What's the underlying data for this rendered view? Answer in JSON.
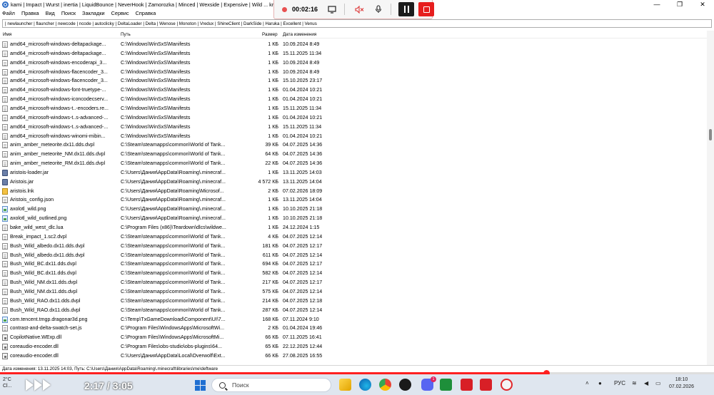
{
  "window": {
    "title": "kami | Impact | Wurst | inertia | LiquidBounce | NeverHook | Zamorozka | Minced | Wexside | Expensive | Wild ... krien | celestial | calestial | deadcode | nova-dev | Bebra... - Everything",
    "controls": [
      "—",
      "❐",
      "✕"
    ]
  },
  "recorder": {
    "time": "00:02:16"
  },
  "menu": [
    "Файл",
    "Правка",
    "Вид",
    "Поиск",
    "Закладки",
    "Сервис",
    "Справка"
  ],
  "bookmarks": "| newlauncher | flauncher | newcode | ncode | autoclicky | DeltaLoader | Delta | Wenose | Monoton | Vredux | ShineClient | DarkSide | Haruka | Excellent | Venus",
  "columns": {
    "name": "Имя",
    "path": "Путь",
    "size": "Размер",
    "date": "Дата изменения"
  },
  "rows": [
    {
      "icon": "doc",
      "name": "amd64_microsoft-windows-deltapackage...",
      "path": "C:\\Windows\\WinSxS\\Manifests",
      "size": "1 КБ",
      "date": "10.09.2024 8:49"
    },
    {
      "icon": "doc",
      "name": "amd64_microsoft-windows-deltapackage...",
      "path": "C:\\Windows\\WinSxS\\Manifests",
      "size": "1 КБ",
      "date": "15.11.2025 11:34"
    },
    {
      "icon": "doc",
      "name": "amd64_microsoft-windows-encoderapi_3...",
      "path": "C:\\Windows\\WinSxS\\Manifests",
      "size": "1 КБ",
      "date": "10.09.2024 8:49"
    },
    {
      "icon": "doc",
      "name": "amd64_microsoft-windows-flacencoder_3...",
      "path": "C:\\Windows\\WinSxS\\Manifests",
      "size": "1 КБ",
      "date": "10.09.2024 8:49"
    },
    {
      "icon": "doc",
      "name": "amd64_microsoft-windows-flacencoder_3...",
      "path": "C:\\Windows\\WinSxS\\Manifests",
      "size": "1 КБ",
      "date": "15.10.2025 23:17"
    },
    {
      "icon": "doc",
      "name": "amd64_microsoft-windows-font-truetype-...",
      "path": "C:\\Windows\\WinSxS\\Manifests",
      "size": "1 КБ",
      "date": "01.04.2024 10:21"
    },
    {
      "icon": "doc",
      "name": "amd64_microsoft-windows-iconcodecserv...",
      "path": "C:\\Windows\\WinSxS\\Manifests",
      "size": "1 КБ",
      "date": "01.04.2024 10:21"
    },
    {
      "icon": "doc",
      "name": "amd64_microsoft-windows-t..-encoders.re...",
      "path": "C:\\Windows\\WinSxS\\Manifests",
      "size": "1 КБ",
      "date": "15.11.2025 11:34"
    },
    {
      "icon": "doc",
      "name": "amd64_microsoft-windows-t..s-advanced-...",
      "path": "C:\\Windows\\WinSxS\\Manifests",
      "size": "1 КБ",
      "date": "01.04.2024 10:21"
    },
    {
      "icon": "doc",
      "name": "amd64_microsoft-windows-t..s-advanced-...",
      "path": "C:\\Windows\\WinSxS\\Manifests",
      "size": "1 КБ",
      "date": "15.11.2025 11:34"
    },
    {
      "icon": "doc",
      "name": "amd64_microsoft-windows-winomi-mibin...",
      "path": "C:\\Windows\\WinSxS\\Manifests",
      "size": "1 КБ",
      "date": "01.04.2024 10:21"
    },
    {
      "icon": "doc",
      "name": "anim_amber_meteorite.dx11.dds.dvpl",
      "path": "C:\\Steam\\steamapps\\common\\World of Tank...",
      "size": "39 КБ",
      "date": "04.07.2025 14:36"
    },
    {
      "icon": "doc",
      "name": "anim_amber_meteorite_NM.dx11.dds.dvpl",
      "path": "C:\\Steam\\steamapps\\common\\World of Tank...",
      "size": "64 КБ",
      "date": "04.07.2025 14:36"
    },
    {
      "icon": "doc",
      "name": "anim_amber_meteorite_RM.dx11.dds.dvpl",
      "path": "C:\\Steam\\steamapps\\common\\World of Tank...",
      "size": "22 КБ",
      "date": "04.07.2025 14:36"
    },
    {
      "icon": "jar",
      "name": "aristois-loader.jar",
      "path": "C:\\Users\\Дания\\AppData\\Roaming\\.minecraf...",
      "size": "1 КБ",
      "date": "13.11.2025 14:03"
    },
    {
      "icon": "jar",
      "name": "Aristois.jar",
      "path": "C:\\Users\\Дания\\AppData\\Roaming\\.minecraf...",
      "size": "4 572 КБ",
      "date": "13.11.2025 14:04"
    },
    {
      "icon": "lnk",
      "name": "aristois.lnk",
      "path": "C:\\Users\\Дания\\AppData\\Roaming\\Microsof...",
      "size": "2 КБ",
      "date": "07.02.2026 18:09"
    },
    {
      "icon": "doc",
      "name": "Aristois_config.json",
      "path": "C:\\Users\\Дания\\AppData\\Roaming\\.minecraf...",
      "size": "1 КБ",
      "date": "13.11.2025 14:04"
    },
    {
      "icon": "img",
      "name": "axolotl_wild.png",
      "path": "C:\\Users\\Дания\\AppData\\Roaming\\.minecraf...",
      "size": "1 КБ",
      "date": "10.10.2025 21:18"
    },
    {
      "icon": "img",
      "name": "axolotl_wild_outlined.png",
      "path": "C:\\Users\\Дания\\AppData\\Roaming\\.minecraf...",
      "size": "1 КБ",
      "date": "10.10.2025 21:18"
    },
    {
      "icon": "doc",
      "name": "bake_wild_west_dlc.lua",
      "path": "C:\\Program Files (x86)\\Teardown\\dlcs\\wildwe...",
      "size": "1 КБ",
      "date": "24.12.2024 1:15"
    },
    {
      "icon": "doc",
      "name": "Break_impact_1.sc2.dvpl",
      "path": "C:\\Steam\\steamapps\\common\\World of Tank...",
      "size": "4 КБ",
      "date": "04.07.2025 12:14"
    },
    {
      "icon": "doc",
      "name": "Bush_Wild_albedo.dx11.dds.dvpl",
      "path": "C:\\Steam\\steamapps\\common\\World of Tank...",
      "size": "181 КБ",
      "date": "04.07.2025 12:17"
    },
    {
      "icon": "doc",
      "name": "Bush_Wild_albedo.dx11.dds.dvpl",
      "path": "C:\\Steam\\steamapps\\common\\World of Tank...",
      "size": "611 КБ",
      "date": "04.07.2025 12:14"
    },
    {
      "icon": "doc",
      "name": "Bush_Wild_BC.dx11.dds.dvpl",
      "path": "C:\\Steam\\steamapps\\common\\World of Tank...",
      "size": "694 КБ",
      "date": "04.07.2025 12:17"
    },
    {
      "icon": "doc",
      "name": "Bush_Wild_BC.dx11.dds.dvpl",
      "path": "C:\\Steam\\steamapps\\common\\World of Tank...",
      "size": "582 КБ",
      "date": "04.07.2025 12:14"
    },
    {
      "icon": "doc",
      "name": "Bush_Wild_NM.dx11.dds.dvpl",
      "path": "C:\\Steam\\steamapps\\common\\World of Tank...",
      "size": "217 КБ",
      "date": "04.07.2025 12:17"
    },
    {
      "icon": "doc",
      "name": "Bush_Wild_NM.dx11.dds.dvpl",
      "path": "C:\\Steam\\steamapps\\common\\World of Tank...",
      "size": "575 КБ",
      "date": "04.07.2025 12:14"
    },
    {
      "icon": "doc",
      "name": "Bush_Wild_RAO.dx11.dds.dvpl",
      "path": "C:\\Steam\\steamapps\\common\\World of Tank...",
      "size": "214 КБ",
      "date": "04.07.2025 12:18"
    },
    {
      "icon": "doc",
      "name": "Bush_Wild_RAO.dx11.dds.dvpl",
      "path": "C:\\Steam\\steamapps\\common\\World of Tank...",
      "size": "287 КБ",
      "date": "04.07.2025 12:14"
    },
    {
      "icon": "img",
      "name": "com.tencent.tmgp.dragonar3d.png",
      "path": "C:\\Temp\\TxGameDownload\\Component\\UI\\7...",
      "size": "168 КБ",
      "date": "07.11.2024 9:10"
    },
    {
      "icon": "doc",
      "name": "contrast-and-delta-swatch-set.js",
      "path": "C:\\Program Files\\WindowsApps\\MicrosoftWi...",
      "size": "2 КБ",
      "date": "01.04.2024 19:46"
    },
    {
      "icon": "dll",
      "name": "CopilotNative.WExp.dll",
      "path": "C:\\Program Files\\WindowsApps\\MicrosoftMi...",
      "size": "66 КБ",
      "date": "07.11.2025 16:41"
    },
    {
      "icon": "dll",
      "name": "coreaudio-encoder.dll",
      "path": "C:\\Program Files\\obs-studio\\obs-plugins\\64...",
      "size": "65 КБ",
      "date": "22.12.2025 12:44"
    },
    {
      "icon": "dll",
      "name": "coreaudio-encoder.dll",
      "path": "C:\\Users\\Дания\\AppData\\Local\\Overwolf\\Ext...",
      "size": "66 КБ",
      "date": "27.08.2025 16:55"
    }
  ],
  "status": "Дата изменения: 13.11.2025 14:03, Путь: C:\\Users\\Дания\\AppData\\Roaming\\.minecraft\\libraries\\me\\deftware",
  "video": {
    "time": "2:17 / 3:05",
    "progress": 0.765,
    "accent": "#ff2020"
  },
  "taskbar": {
    "weather_temp": "2°C",
    "weather_text": "Cl...",
    "search_placeholder": "Поиск",
    "badge": "1",
    "lang": "РУС",
    "time": "18:10",
    "date": "07.02.2026"
  }
}
